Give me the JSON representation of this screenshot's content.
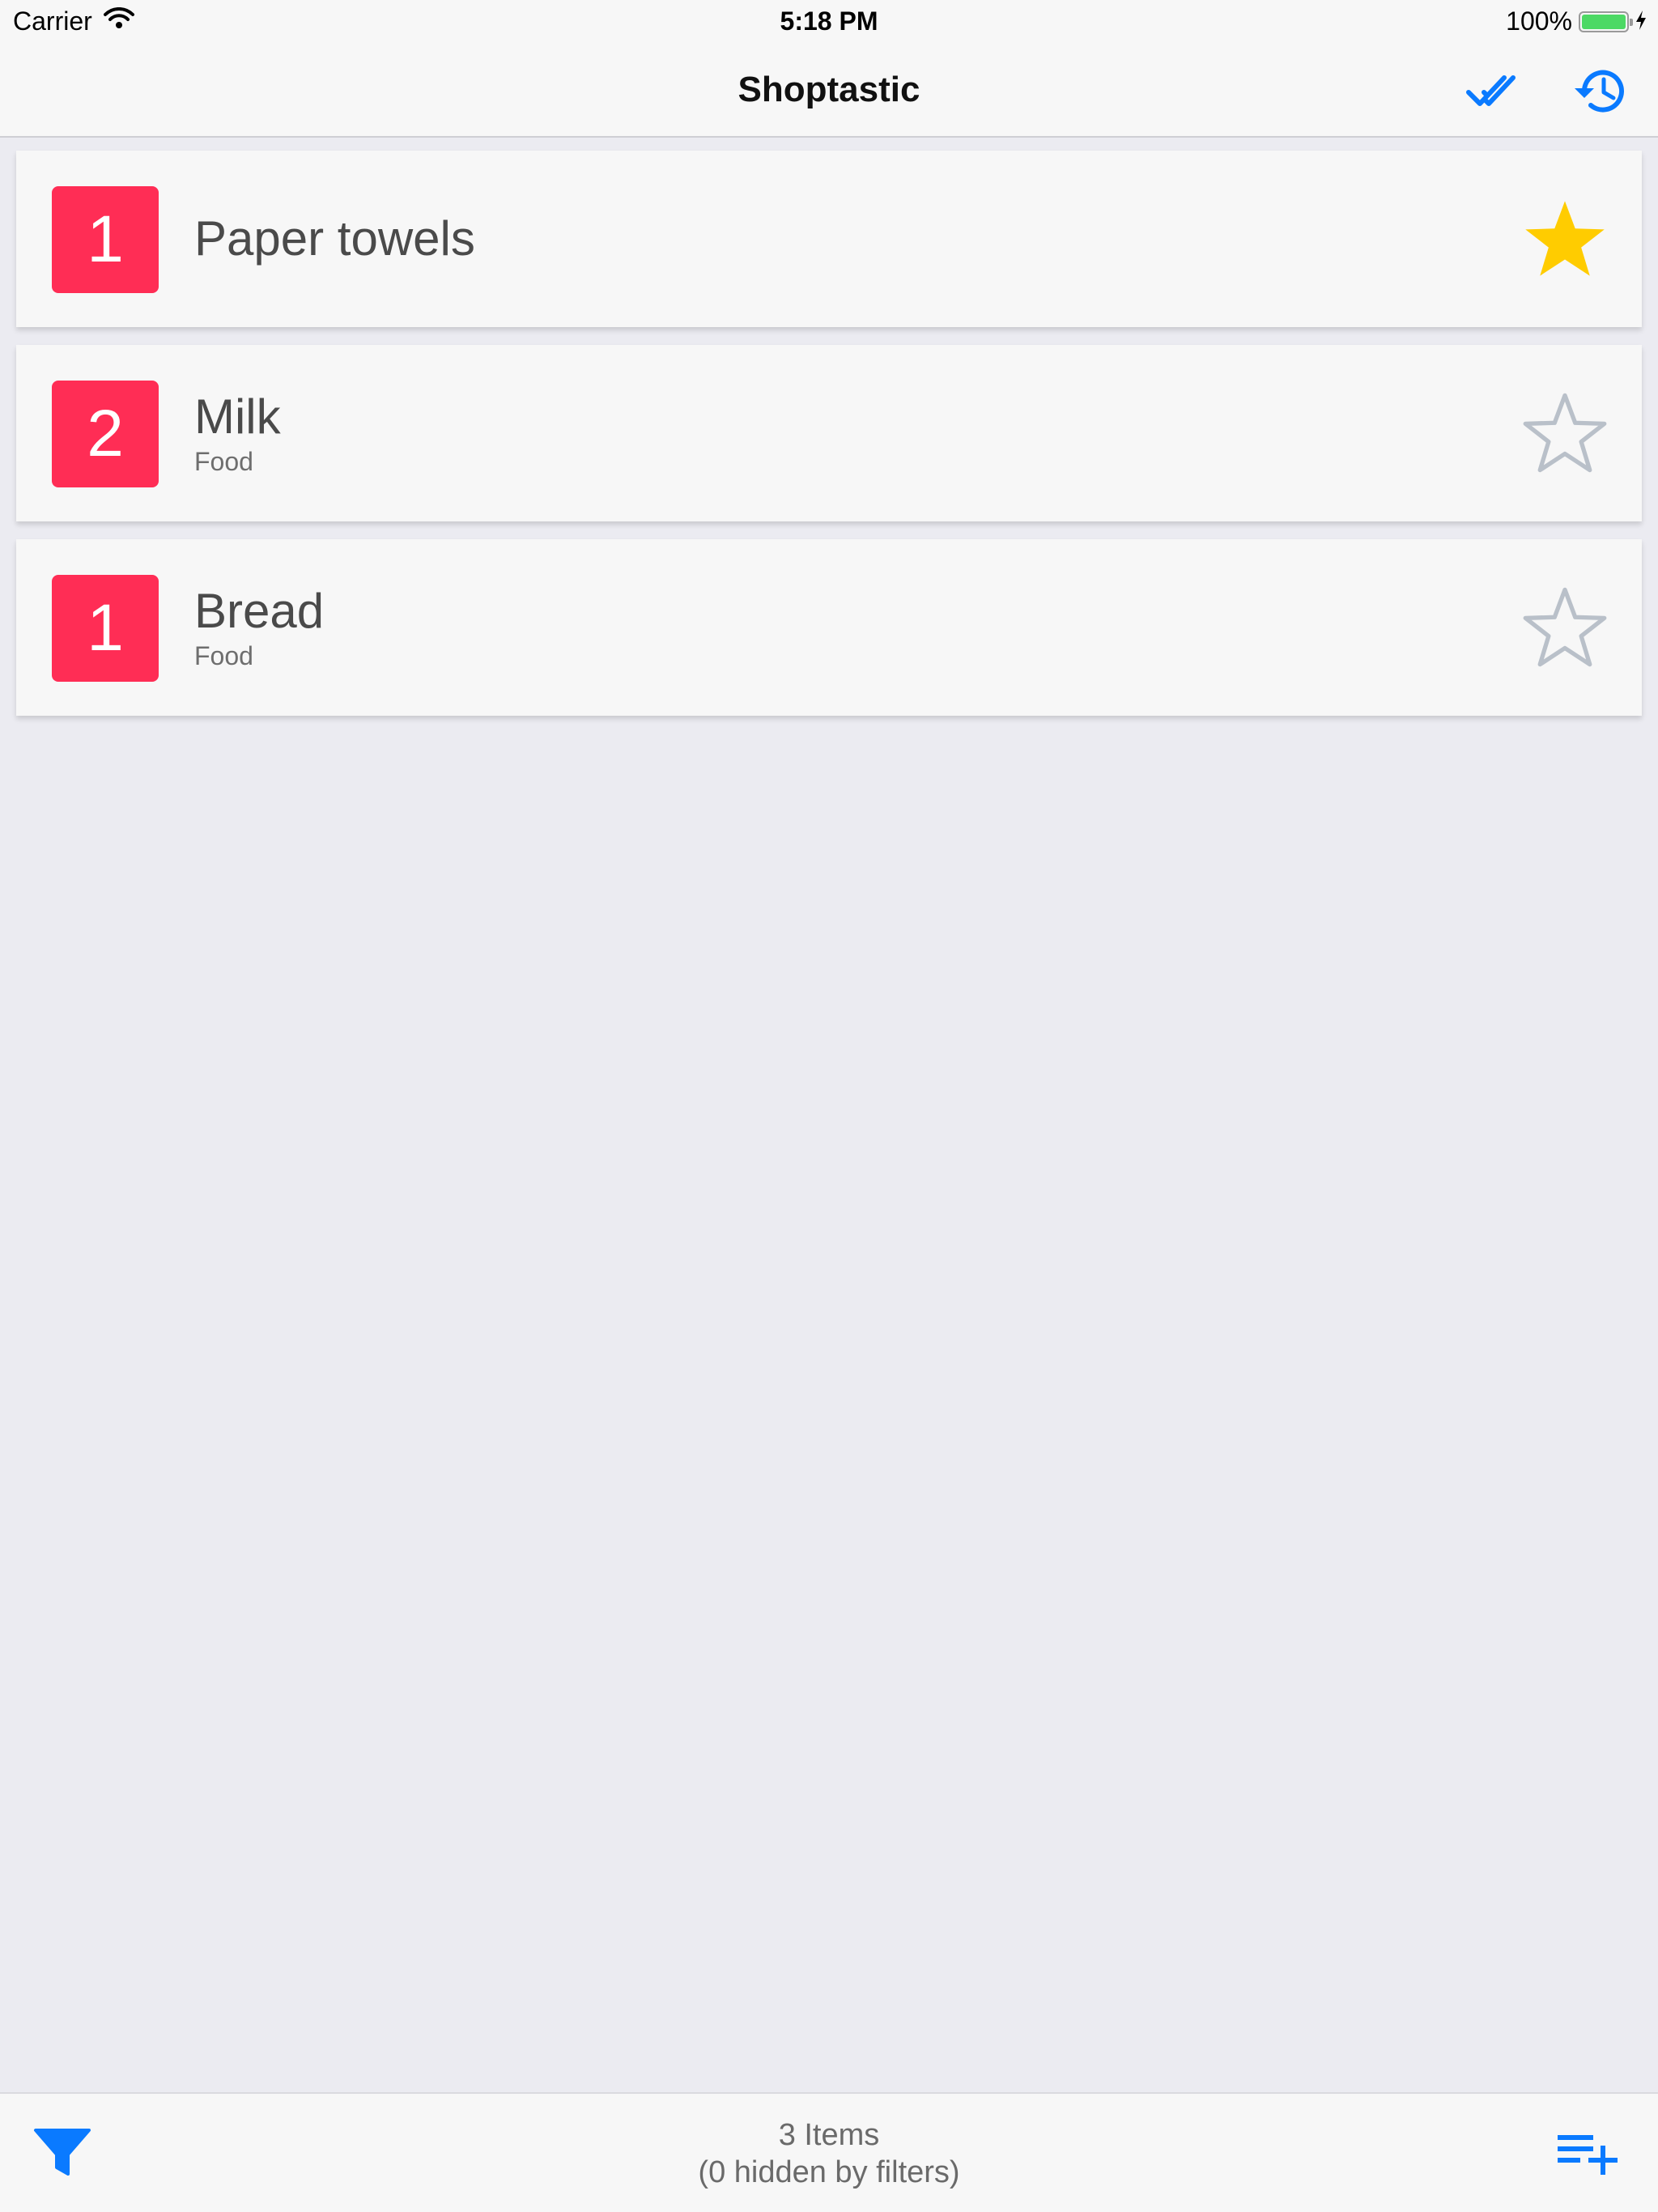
{
  "status_bar": {
    "carrier": "Carrier",
    "time": "5:18 PM",
    "battery": "100%"
  },
  "nav": {
    "title": "Shoptastic"
  },
  "items": [
    {
      "quantity": "1",
      "name": "Paper towels",
      "category": "",
      "favorite": true
    },
    {
      "quantity": "2",
      "name": "Milk",
      "category": "Food",
      "favorite": false
    },
    {
      "quantity": "1",
      "name": "Bread",
      "category": "Food",
      "favorite": false
    }
  ],
  "toolbar": {
    "count": "3 Items",
    "hidden": "(0 hidden by filters)"
  },
  "colors": {
    "accent": "#0A7AFF",
    "quantity_badge": "#FF2D55",
    "star_filled": "#FFCC00",
    "star_outline": "#B9C0C9",
    "battery": "#4CD964"
  },
  "icons": {
    "wifi": "wifi-icon",
    "check_all": "double-check-icon",
    "history": "history-icon",
    "star": "star-icon",
    "filter": "filter-icon",
    "add_list": "playlist-add-icon"
  }
}
